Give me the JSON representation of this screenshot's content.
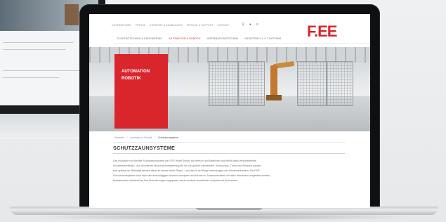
{
  "site": {
    "logo": "F.EE",
    "utility_links": [
      "UNTERNEHMEN",
      "PRESSE",
      "KARRIERE & AUSBILDUNG",
      "SERVICE & SUPPORT",
      "KONTAKT"
    ],
    "utility_icons": [
      "search-icon",
      "language-icon",
      "menu-icon"
    ],
    "nav": [
      {
        "label": "ELEKTROTECHNIK & ENGINEERING",
        "active": false
      },
      {
        "label": "AUTOMATION & ROBOTIK",
        "active": true
      },
      {
        "label": "INFORMATIONSTECHNIK",
        "active": false
      },
      {
        "label": "INDUSTRIE 4.0 / IT SYSTEMS",
        "active": false
      }
    ],
    "hero": {
      "line1": "AUTOMATION",
      "line2": "ROBOTIK"
    },
    "breadcrumb": [
      "Startseite",
      "Automation & Robotik",
      "Schutzzaunsysteme"
    ],
    "heading": "SCHUTZZAUNSYSTEME",
    "paragraph": [
      "Das modulare und flexible Schutzzaunsystem von F.EE bietet Schutz für Mensch und Maschine und erfüllt dabei verschiedenste",
      "Sicherheitskriterien. Von der kleinen Maschinenumwehrung bis hin zur großen roboterzelle: Schutzzaun, Türen und Sensorik passen",
      "sich optimal an. Befestigt werden diese an einem festen Stand – und das in der Regel werkzeuglos mit Schnellverbindern. Die F.EE",
      "Schutzzaunsysteme sind nach den einschlägigen Normen konzipiert und können in Zusammenarbeit mit allen Herstellern umgesetzt werden,",
      "bedarfsweise individuell an Ihre Anforderungen angepasst, sowie modular erweiterbar und jederzeit rückbaubar."
    ]
  }
}
